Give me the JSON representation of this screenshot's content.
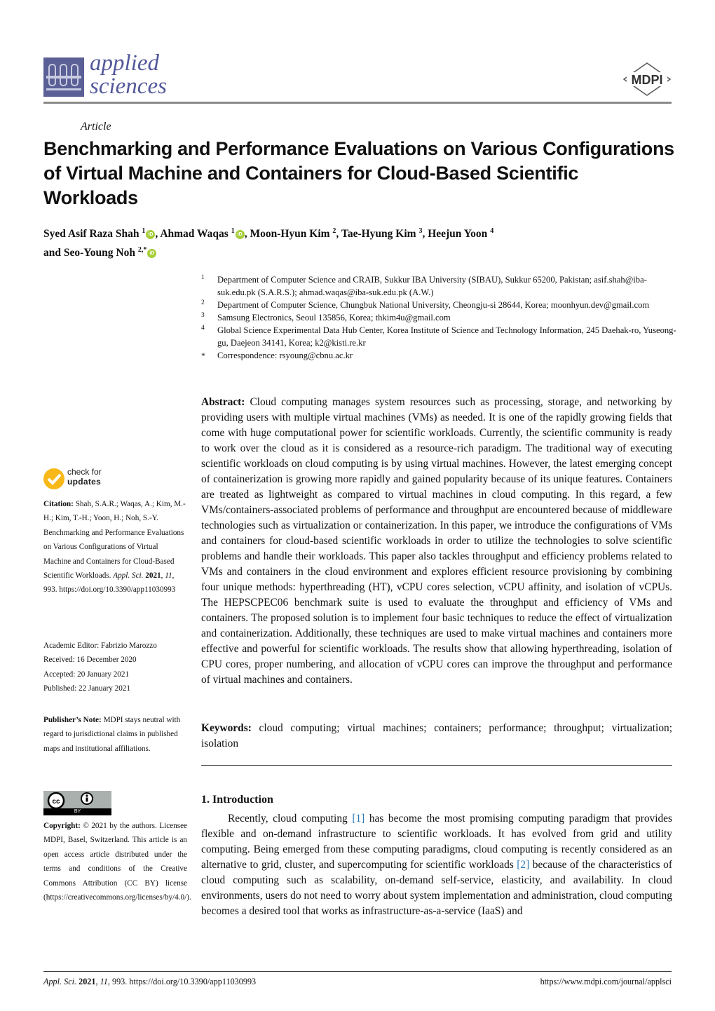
{
  "header": {
    "journal_name_line1": "applied",
    "journal_name_line2": "sciences",
    "publisher_logo": "MDPI"
  },
  "article": {
    "type": "Article",
    "title": "Benchmarking and Performance Evaluations on Various Configurations of Virtual Machine and Containers for Cloud-Based Scientific Workloads",
    "authors": [
      {
        "name": "Syed Asif Raza Shah",
        "aff": "1",
        "orcid": true
      },
      {
        "name": "Ahmad Waqas",
        "aff": "1",
        "orcid": true
      },
      {
        "name": "Moon-Hyun Kim",
        "aff": "2",
        "orcid": false
      },
      {
        "name": "Tae-Hyung Kim",
        "aff": "3",
        "orcid": false
      },
      {
        "name": "Heejun Yoon",
        "aff": "4",
        "orcid": false
      },
      {
        "name": "Seo-Young Noh",
        "aff": "2,*",
        "orcid": true
      }
    ],
    "authors_conjunction": "and",
    "orcid_icon_label": "iD",
    "affiliations": [
      {
        "num": "1",
        "text": "Department of Computer Science and CRAIB, Sukkur IBA University (SIBAU), Sukkur 65200, Pakistan; asif.shah@iba-suk.edu.pk (S.A.R.S.); ahmad.waqas@iba-suk.edu.pk (A.W.)"
      },
      {
        "num": "2",
        "text": "Department of Computer Science, Chungbuk National University, Cheongju-si 28644, Korea; moonhyun.dev@gmail.com"
      },
      {
        "num": "3",
        "text": "Samsung Electronics, Seoul 135856, Korea; thkim4u@gmail.com"
      },
      {
        "num": "4",
        "text": "Global Science Experimental Data Hub Center, Korea Institute of Science and Technology Information, 245 Daehak-ro, Yuseong-gu, Daejeon 34141, Korea; k2@kisti.re.kr"
      },
      {
        "num": "*",
        "text": "Correspondence: rsyoung@cbnu.ac.kr"
      }
    ],
    "abstract_label": "Abstract:",
    "abstract": "Cloud computing manages system resources such as processing, storage, and networking by providing users with multiple virtual machines (VMs) as needed. It is one of the rapidly growing fields that come with huge computational power for scientific workloads. Currently, the scientific community is ready to work over the cloud as it is considered as a resource-rich paradigm.  The traditional way of executing scientific workloads on cloud computing is by using virtual machines. However, the latest emerging concept of containerization is growing more rapidly and gained popularity because of its unique features.  Containers are treated as lightweight as compared to virtual machines in cloud computing. In this regard, a few VMs/containers-associated problems of performance and throughput are encountered because of middleware technologies such as virtualization or containerization. In this paper, we introduce the configurations of VMs and containers for cloud-based scientific workloads in order to utilize the technologies to solve scientific problems and handle their workloads. This paper also tackles throughput and efficiency problems related to VMs and containers in the cloud environment and explores efficient resource provisioning by combining four unique methods: hyperthreading (HT), vCPU cores selection, vCPU affinity, and isolation of vCPUs.  The HEPSCPEC06 benchmark suite is used to evaluate the throughput and efficiency of VMs and containers.  The proposed solution is to implement four basic techniques to reduce the effect of virtualization and containerization. Additionally, these techniques are used to make virtual machines and containers more effective and powerful for scientific workloads. The results show that allowing hyperthreading, isolation of CPU cores, proper numbering, and allocation of vCPU cores can improve the throughput and performance of virtual machines and containers.",
    "keywords_label": "Keywords:",
    "keywords": "cloud computing; virtual machines; containers; performance; throughput; virtualization; isolation",
    "intro_heading": "1. Introduction",
    "intro_parts": [
      "Recently, cloud computing ",
      "[1]",
      " has become the most promising computing paradigm that provides flexible and on-demand infrastructure to scientific workloads. It has evolved from grid and utility computing. Being emerged from these computing paradigms, cloud computing is recently considered as an alternative to grid, cluster, and supercomputing for scientific workloads ",
      "[2]",
      " because of the characteristics of cloud computing such as scalability, on-demand self-service, elasticity, and availability.  In cloud environments, users do not need to worry about system implementation and administration, cloud computing becomes a desired tool that works as infrastructure-as-a-service (IaaS) and"
    ]
  },
  "sidebar": {
    "check_updates_line1": "check for",
    "check_updates_line2": "updates",
    "citation_label": "Citation:",
    "citation_text": "Shah, S.A.R.; Waqas, A.; Kim, M.-H.; Kim, T.-H.; Yoon, H.; Noh, S.-Y. Benchmarking and Performance Evaluations on Various Configurations of Virtual Machine and Containers for Cloud-Based Scientific Workloads.",
    "citation_journal": "Appl. Sci.",
    "citation_year": "2021",
    "citation_volume": "11",
    "citation_rest": ", 993. https://doi.org/10.3390/app11030993",
    "academic_editor": "Academic Editor: Fabrizio Marozzo",
    "received": "Received: 16 December 2020",
    "accepted": "Accepted: 20 January 2021",
    "published": "Published: 22 January 2021",
    "publisher_note_label": "Publisher’s Note:",
    "publisher_note": "MDPI stays neutral with regard to jurisdictional claims in published maps and institutional affiliations.",
    "cc_badge_label": "BY",
    "copyright_label": "Copyright:",
    "copyright_text": "© 2021 by the authors. Licensee MDPI, Basel, Switzerland. This article is an open access article distributed under the terms and conditions of the Creative Commons Attribution (CC BY) license (https://creativecommons.org/licenses/by/4.0/)."
  },
  "footer": {
    "journal": "Appl. Sci.",
    "year": "2021",
    "volume": "11",
    "rest": ", 993. https://doi.org/10.3390/app11030993",
    "url": "https://www.mdpi.com/journal/applsci"
  }
}
